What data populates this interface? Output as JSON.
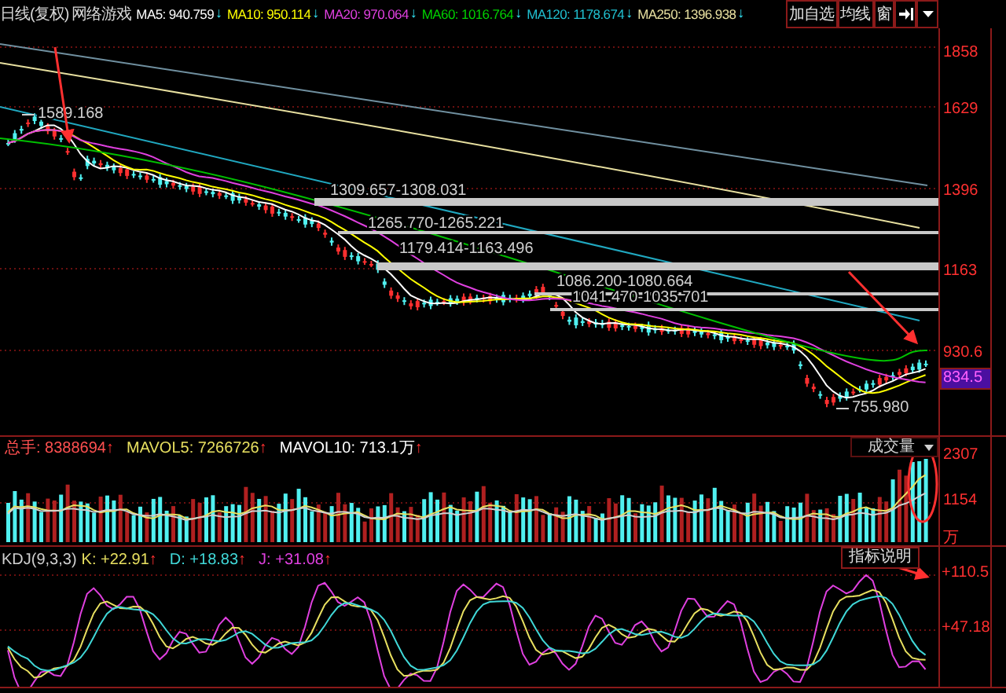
{
  "header": {
    "period": "日线(复权)",
    "sector": "网络游戏",
    "moving_averages": [
      {
        "name": "MA5:",
        "value": "940.759",
        "arrow": "↓",
        "color": "#ffffff"
      },
      {
        "name": "MA10:",
        "value": "950.114",
        "arrow": "↓",
        "color": "#ffff00"
      },
      {
        "name": "MA20:",
        "value": "970.064",
        "arrow": "↓",
        "color": "#e040e0"
      },
      {
        "name": "MA60:",
        "value": "1016.764",
        "arrow": "↓",
        "color": "#00d000"
      },
      {
        "name": "MA120:",
        "value": "1178.674",
        "arrow": "↓",
        "color": "#20c0d0"
      },
      {
        "name": "MA250:",
        "value": "1396.938",
        "arrow": "↓",
        "color": "#e8e0a0"
      }
    ],
    "buttons": [
      "加自选",
      "均线",
      "窗"
    ]
  },
  "price_panel": {
    "axis_labels": [
      "1858",
      "1629",
      "1396",
      "1163",
      "930.6"
    ],
    "current_price": "834.5",
    "annotations": [
      "1589.168",
      "1309.657-1308.031",
      "1265.770-1265.221",
      "1179.414-1163.496",
      "1086.200-1080.664",
      "1041.470-1035.701",
      "755.980"
    ]
  },
  "volume_panel": {
    "stats": [
      {
        "label": "总手:",
        "value": "8388694",
        "arrow": "↑",
        "color": "#ff5050"
      },
      {
        "label": "MAVOL5:",
        "value": "7266726",
        "arrow": "↑",
        "color": "#e8e060"
      },
      {
        "label": "MAVOL10:",
        "value": "713.1万",
        "arrow": "↑",
        "color": "#ffffff"
      }
    ],
    "indicator_menu": "成交量",
    "axis_labels": [
      "2307",
      "1154",
      "万"
    ]
  },
  "kdj_panel": {
    "title": "KDJ(9,3,3)",
    "stats": [
      {
        "label": "K:",
        "value": "+22.91",
        "arrow": "↑",
        "color": "#e8e060"
      },
      {
        "label": "D:",
        "value": "+18.83",
        "arrow": "↑",
        "color": "#40d8d8"
      },
      {
        "label": "J:",
        "value": "+31.08",
        "arrow": "↑",
        "color": "#e040e0"
      }
    ],
    "help_button": "指标说明",
    "axis_labels": [
      "+110.5",
      "+47.18"
    ]
  }
}
